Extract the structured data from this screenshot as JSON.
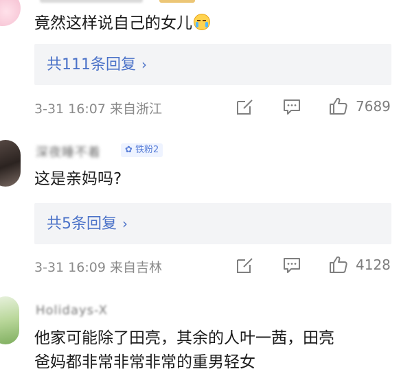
{
  "comments": [
    {
      "text": "竟然这样说自己的女儿",
      "emoji": "cry-laugh-emoji",
      "reply_label": "共111条回复",
      "reply_chevron": "›",
      "meta": "3-31 16:07 来自浙江",
      "likes": "7689"
    },
    {
      "username": "深夜睡不着",
      "badge": "铁粉2",
      "text": "这是亲妈吗?",
      "reply_label": "共5条回复",
      "reply_chevron": "›",
      "meta": "3-31 16:09 来自吉林",
      "likes": "4128"
    },
    {
      "username": "Holidays-X",
      "text_line1": "他家可能除了田亮，其余的人叶一茜，田亮",
      "text_line2": "爸妈都非常非常非常的重男轻女"
    }
  ],
  "colors": {
    "link": "#4b72c8",
    "meta": "#8a8a8a",
    "reply_bg": "#f3f4f6"
  },
  "icons": [
    "edit-icon",
    "comment-icon",
    "like-icon"
  ]
}
